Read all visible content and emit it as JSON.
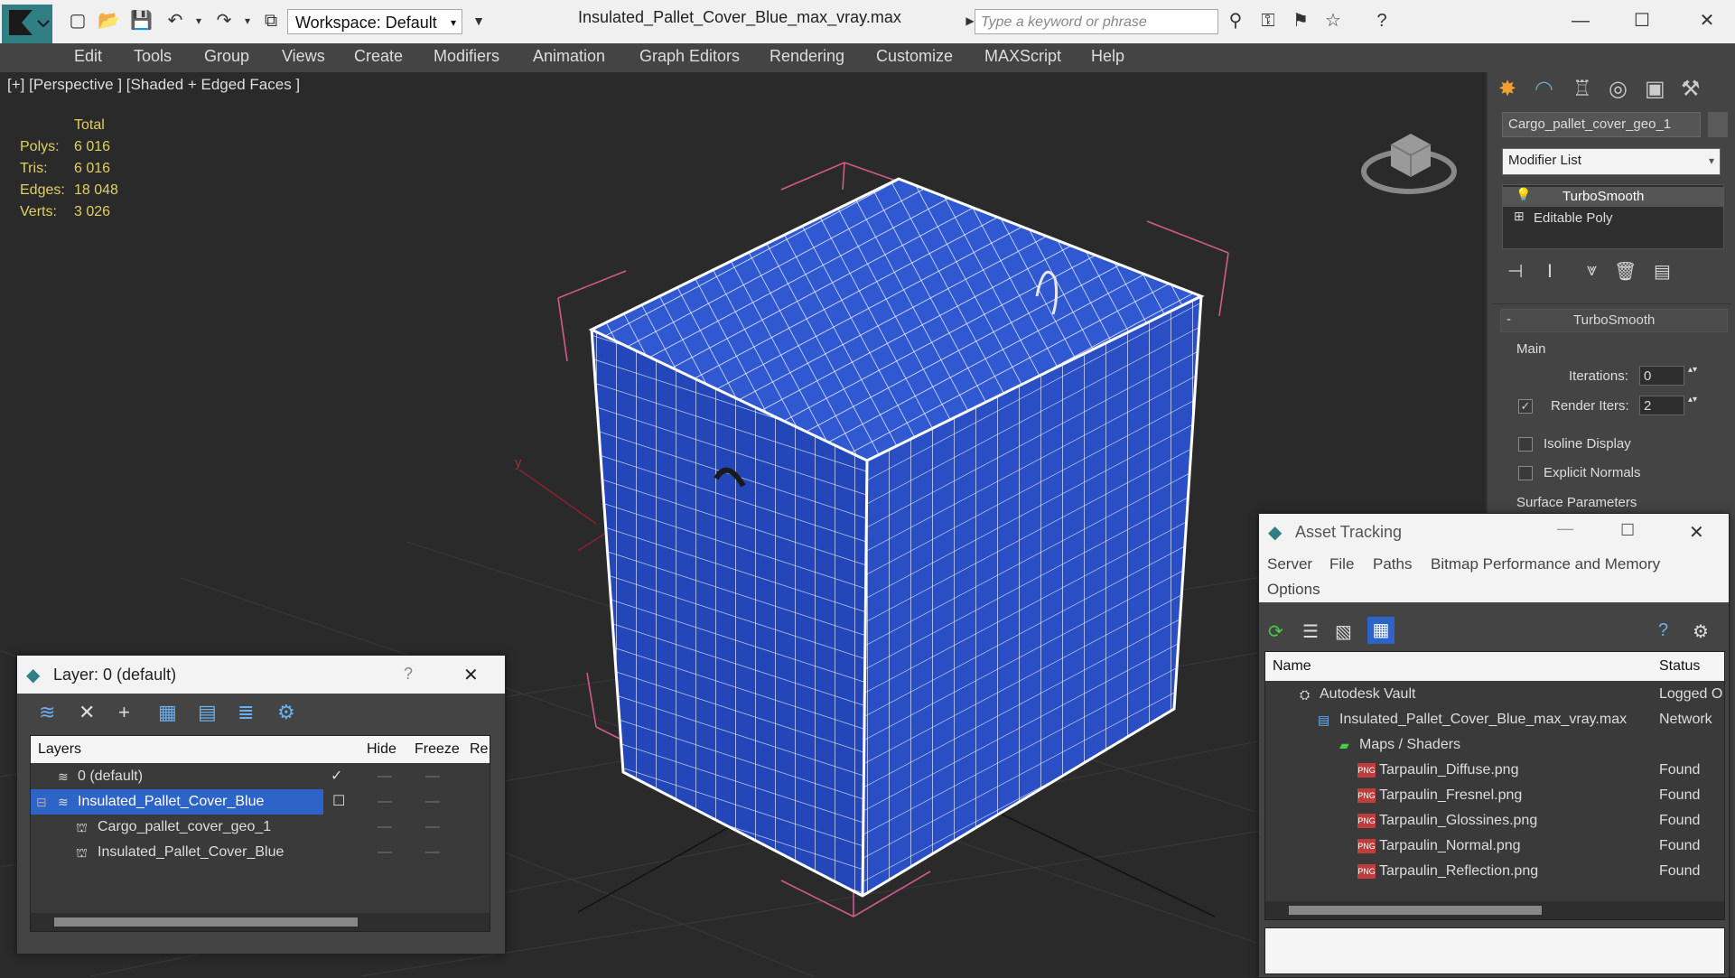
{
  "window": {
    "title": "Insulated_Pallet_Cover_Blue_max_vray.max"
  },
  "toolbar": {
    "workspace_label": "Workspace: Default",
    "search_placeholder": "Type a keyword or phrase"
  },
  "menu": [
    "Edit",
    "Tools",
    "Group",
    "Views",
    "Create",
    "Modifiers",
    "Animation",
    "Graph Editors",
    "Rendering",
    "Customize",
    "MAXScript",
    "Help"
  ],
  "viewport": {
    "label": "[+] [Perspective ] [Shaded + Edged Faces ]",
    "stats_header": "Total",
    "stats": [
      {
        "label": "Polys:",
        "value": "6 016"
      },
      {
        "label": "Tris:",
        "value": "6 016"
      },
      {
        "label": "Edges:",
        "value": "18 048"
      },
      {
        "label": "Verts:",
        "value": "3 026"
      }
    ],
    "axis_y": "y"
  },
  "command_panel": {
    "object_name": "Cargo_pallet_cover_geo_1",
    "modifier_list": "Modifier List",
    "stack": [
      "TurboSmooth",
      "Editable Poly"
    ],
    "rollout_title": "TurboSmooth",
    "group_main": "Main",
    "iterations_label": "Iterations:",
    "iterations_value": "0",
    "render_iters_label": "Render Iters:",
    "render_iters_value": "2",
    "isoline_label": "Isoline Display",
    "explicit_normals_label": "Explicit Normals",
    "surface_params": "Surface Parameters"
  },
  "layer_window": {
    "title": "Layer: 0 (default)",
    "help": "?",
    "columns": [
      "Layers",
      "Hide",
      "Freeze",
      "Re"
    ],
    "rows": [
      {
        "name": "0 (default)"
      },
      {
        "name": "Insulated_Pallet_Cover_Blue"
      },
      {
        "name": "Cargo_pallet_cover_geo_1"
      },
      {
        "name": "Insulated_Pallet_Cover_Blue"
      }
    ]
  },
  "asset_window": {
    "title": "Asset Tracking",
    "menu": [
      "Server",
      "File",
      "Paths",
      "Bitmap Performance and Memory",
      "Options"
    ],
    "columns": [
      "Name",
      "Status"
    ],
    "rows": [
      {
        "name": "Autodesk Vault",
        "status": "Logged O"
      },
      {
        "name": "Insulated_Pallet_Cover_Blue_max_vray.max",
        "status": "Network"
      },
      {
        "name": "Maps / Shaders",
        "status": ""
      },
      {
        "name": "Tarpaulin_Diffuse.png",
        "status": "Found"
      },
      {
        "name": "Tarpaulin_Fresnel.png",
        "status": "Found"
      },
      {
        "name": "Tarpaulin_Glossines.png",
        "status": "Found"
      },
      {
        "name": "Tarpaulin_Normal.png",
        "status": "Found"
      },
      {
        "name": "Tarpaulin_Reflection.png",
        "status": "Found"
      }
    ]
  },
  "colors": {
    "mesh_blue": "#2346b8",
    "selection_highlight": "#2e63c8",
    "bbox_pink": "#d25a8c",
    "stat_yellow": "#e0d060"
  },
  "icons": [
    "app-logo-icon",
    "new-file-icon",
    "open-icon",
    "save-icon",
    "undo-icon",
    "redo-icon",
    "minimize-icon",
    "maximize-icon",
    "close-icon",
    "viewcube-icon",
    "png-file-icon"
  ]
}
